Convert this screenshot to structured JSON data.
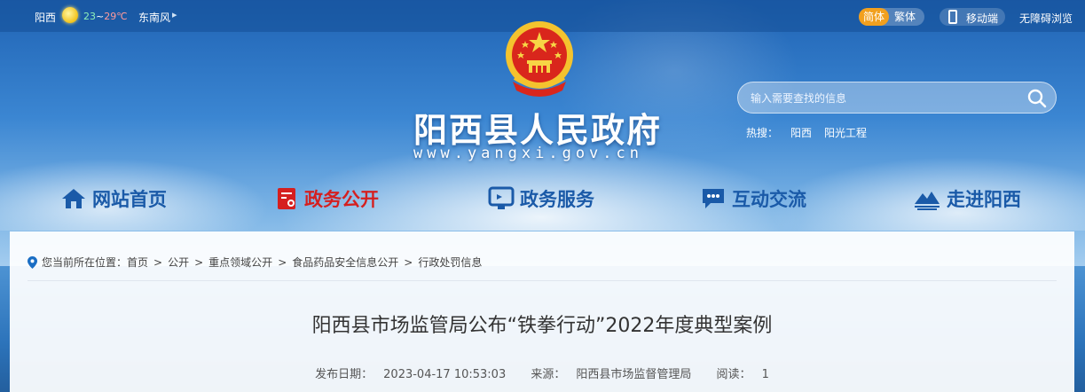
{
  "topbar": {
    "city": "阳西",
    "temp_low": "23",
    "temp_sep": "~",
    "temp_high": "29℃",
    "wind": "东南风",
    "lang_simplified": "简体",
    "lang_traditional": "繁体",
    "mobile_label": "移动端",
    "accessibility_label": "无障碍浏览"
  },
  "header": {
    "site_title": "阳西县人民政府",
    "site_url": "www.yangxi.gov.cn"
  },
  "search": {
    "placeholder": "输入需要查找的信息",
    "hot_label": "热搜：",
    "hot_terms": [
      "阳西",
      "阳光工程"
    ]
  },
  "nav": {
    "items": [
      {
        "label": "网站首页",
        "icon": "home-icon"
      },
      {
        "label": "政务公开",
        "icon": "document-icon",
        "active": true
      },
      {
        "label": "政务服务",
        "icon": "monitor-icon"
      },
      {
        "label": "互动交流",
        "icon": "chat-icon"
      },
      {
        "label": "走进阳西",
        "icon": "landscape-icon"
      }
    ]
  },
  "breadcrumb": {
    "prefix": "您当前所在位置：",
    "items": [
      "首页",
      "公开",
      "重点领域公开",
      "食品药品安全信息公开",
      "行政处罚信息"
    ],
    "separator": ">"
  },
  "article": {
    "title": "阳西县市场监管局公布“铁拳行动”2022年度典型案例",
    "publish_label": "发布日期：",
    "publish_date": "2023-04-17 10:53:03",
    "source_label": "来源：",
    "source": "阳西县市场监督管理局",
    "reads_label": "阅读：",
    "reads": "1"
  },
  "colors": {
    "nav_text": "#1a5aa8",
    "nav_active": "#d51f1f",
    "lang_badge": "#f2a01e"
  }
}
